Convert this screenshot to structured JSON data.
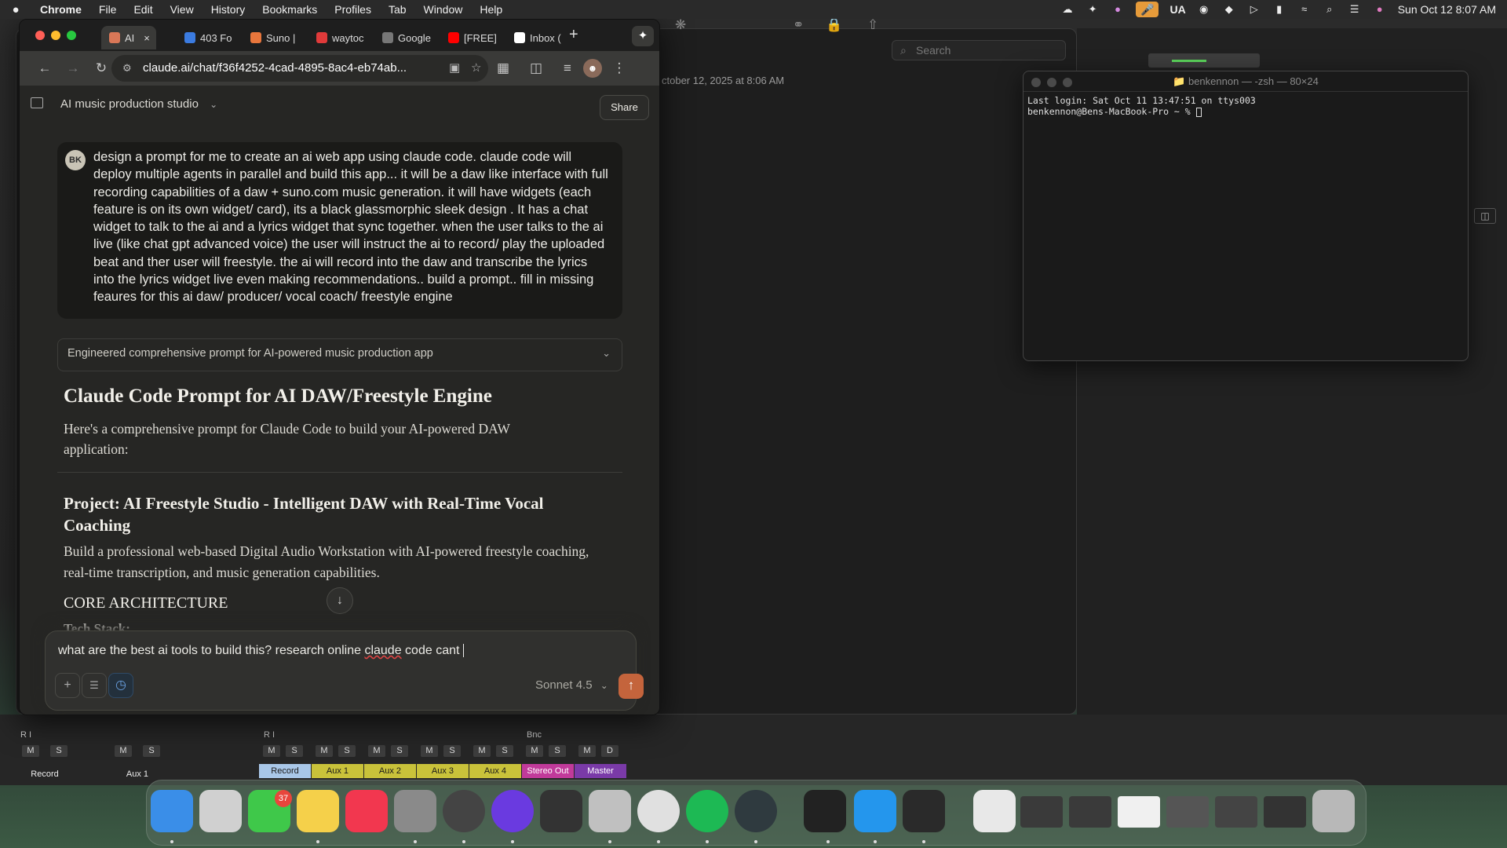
{
  "menubar": {
    "apple": "",
    "app": "Chrome",
    "items": [
      "File",
      "Edit",
      "View",
      "History",
      "Bookmarks",
      "Profiles",
      "Tab",
      "Window",
      "Help"
    ],
    "status_ua": "UA",
    "datetime": "Sun Oct 12  8:07 AM"
  },
  "background_app": {
    "search_placeholder": "Search",
    "date_text": "ctober 12, 2025 at 8:06 AM"
  },
  "terminal": {
    "title": "benkennon — -zsh — 80×24",
    "line1": "Last login: Sat Oct 11 13:47:51 on ttys003",
    "line2": "benkennon@Bens-MacBook-Pro ~ % "
  },
  "browser": {
    "tabs": [
      {
        "label": "AI",
        "icon": "claude-icon",
        "color": "#d97757"
      },
      {
        "label": "403 Fo",
        "icon": "blue-globe-icon",
        "color": "#3b7be0"
      },
      {
        "label": "Suno |",
        "icon": "suno-icon",
        "color": "#e8763c"
      },
      {
        "label": "waytoc",
        "icon": "red-b-icon",
        "color": "#e03a3a"
      },
      {
        "label": "Google",
        "icon": "link-icon",
        "color": "#777777"
      },
      {
        "label": "[FREE]",
        "icon": "youtube-icon",
        "color": "#ff0000"
      },
      {
        "label": "Inbox (",
        "icon": "gmail-icon",
        "color": "#ffffff"
      }
    ],
    "url": "claude.ai/chat/f36f4252-4cad-4895-8ac4-eb74ab..."
  },
  "claude": {
    "conversation_title": "AI music production studio",
    "share_label": "Share",
    "user_initials": "BK",
    "user_message": "design a prompt for me to create an ai web app using claude code. claude code will deploy multiple agents in parallel and build this app... it will be a daw like interface with full recording capabilities of a daw + suno.com music generation. it will have widgets (each feature is on its own widget/ card), its a black glassmorphic sleek design . It has a chat widget to talk to the ai and a lyrics widget that sync together. when the user talks to the ai live (like chat gpt advanced voice) the user will instruct the ai to record/ play the uploaded beat and ther user will freestyle. the ai will record into the daw and transcribe the lyrics into the lyrics widget live even making recommendations.. build a prompt.. fill in missing feaures for this ai daw/ producer/ vocal coach/ freestyle engine",
    "thinking_summary": "Engineered comprehensive prompt for AI-powered music production app",
    "response_heading": "Claude Code Prompt for AI DAW/Freestyle Engine",
    "response_intro": "Here's a comprehensive prompt for Claude Code to build your AI-powered DAW application:",
    "project_heading": "Project: AI Freestyle Studio - Intelligent DAW with Real-Time Vocal Coaching",
    "project_paragraph": "Build a professional web-based Digital Audio Workstation with AI-powered freestyle coaching, real-time transcription, and music generation capabilities.",
    "section_heading": "CORE ARCHITECTURE",
    "subsection_heading": "Tech Stack:",
    "composer_pre": "what are the best ai tools to build this? research online ",
    "composer_misspelled": "claude",
    "composer_post": " code cant ",
    "model_label": "Sonnet 4.5"
  },
  "mixer": {
    "left_channels": [
      {
        "name": "Record",
        "m": "M",
        "s": "S",
        "ri": "R  I"
      },
      {
        "name": "Aux 1",
        "m": "M",
        "s": "S"
      }
    ],
    "channels": [
      {
        "name": "Record",
        "color": "#a9c7e8",
        "text": "#1a1a1a",
        "m": "M",
        "s": "S"
      },
      {
        "name": "Aux 1",
        "color": "#c9c23a",
        "text": "#1a1a1a",
        "m": "M",
        "s": "S"
      },
      {
        "name": "Aux 2",
        "color": "#c9c23a",
        "text": "#1a1a1a",
        "m": "M",
        "s": "S"
      },
      {
        "name": "Aux 3",
        "color": "#c9c23a",
        "text": "#1a1a1a",
        "m": "M",
        "s": "S"
      },
      {
        "name": "Aux 4",
        "color": "#c9c23a",
        "text": "#1a1a1a",
        "m": "M",
        "s": "S"
      },
      {
        "name": "Stereo Out",
        "color": "#c13a9a",
        "text": "#ffffff",
        "m": "M",
        "s": "S"
      },
      {
        "name": "Master",
        "color": "#7a3aa8",
        "text": "#ffffff",
        "m": "M",
        "s": "D"
      }
    ],
    "ri_label": "R  I",
    "bnc_label": "Bnc"
  },
  "dock": {
    "messages_badge": "37",
    "apps": [
      {
        "name": "finder-icon",
        "color": "#3a8ee8"
      },
      {
        "name": "launchpad-icon",
        "color": "#d0d0d0"
      },
      {
        "name": "messages-icon",
        "color": "#3fc84a"
      },
      {
        "name": "notes-icon",
        "color": "#f5d04a"
      },
      {
        "name": "music-icon",
        "color": "#f2374f"
      },
      {
        "name": "system-settings-icon",
        "color": "#8a8a8a"
      },
      {
        "name": "logic-remote-icon",
        "color": "#444444"
      },
      {
        "name": "pro-tools-icon",
        "color": "#6a3ae0"
      },
      {
        "name": "mixer-app-icon",
        "color": "#333333"
      },
      {
        "name": "logic-pro-icon",
        "color": "#c0c0c0"
      },
      {
        "name": "chrome-icon",
        "color": "#e0e0e0"
      },
      {
        "name": "spotify-icon",
        "color": "#1db954"
      },
      {
        "name": "electron-icon",
        "color": "#2f3a3f"
      },
      {
        "name": "terminal-icon",
        "color": "#222222"
      },
      {
        "name": "docker-icon",
        "color": "#2496ed"
      },
      {
        "name": "audio-hijack-icon",
        "color": "#2a2a2a"
      },
      {
        "name": "itunes-doc-icon",
        "color": "#e8e8e8"
      },
      {
        "name": "window-thumbnail-icon",
        "color": "#3a3a3a"
      },
      {
        "name": "window-thumbnail-icon",
        "color": "#3a3a3a"
      },
      {
        "name": "window-thumbnail-icon",
        "color": "#f0f0f0"
      },
      {
        "name": "window-thumbnail-icon",
        "color": "#555555"
      },
      {
        "name": "window-thumbnail-icon",
        "color": "#444444"
      },
      {
        "name": "window-thumbnail-icon",
        "color": "#333333"
      },
      {
        "name": "trash-icon",
        "color": "#b8b8b8"
      }
    ]
  }
}
